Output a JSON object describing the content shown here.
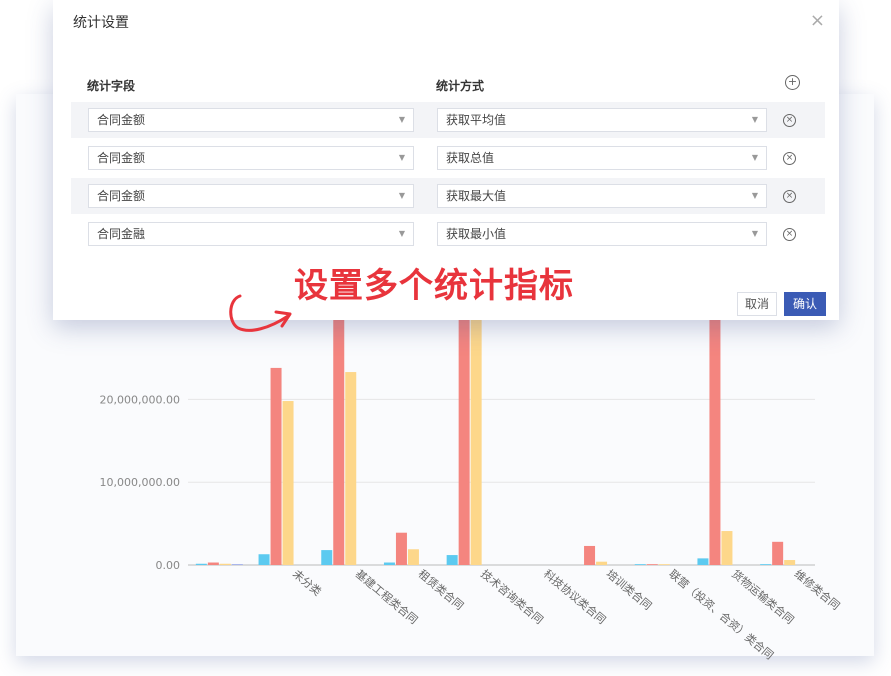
{
  "dialog": {
    "title": "统计设置",
    "close_glyph": "×",
    "field_header": "统计字段",
    "method_header": "统计方式",
    "rows": [
      {
        "field": "合同金额",
        "method": "获取平均值"
      },
      {
        "field": "合同金额",
        "method": "获取总值"
      },
      {
        "field": "合同金额",
        "method": "获取最大值"
      },
      {
        "field": "合同金融",
        "method": "获取最小值"
      }
    ],
    "cancel_label": "取消",
    "ok_label": "确认"
  },
  "annotation": {
    "text": "设置多个统计指标",
    "color": "#e8343c"
  },
  "chart_data": {
    "type": "bar",
    "categories": [
      "",
      "未分类",
      "基建工程类合同",
      "租赁类合同",
      "技术咨询类合同",
      "科技协议类合同",
      "培训类合同",
      "联营（投资、合资）类合同",
      "货物运输类合同",
      "维修类合同"
    ],
    "series": [
      {
        "values": [
          150000,
          1300000,
          1800000,
          300000,
          1200000,
          0,
          0,
          100000,
          800000,
          100000
        ]
      },
      {
        "values": [
          300000,
          23800000,
          32000000,
          3900000,
          32000000,
          0,
          2300000,
          100000,
          32000000,
          2800000
        ]
      },
      {
        "values": [
          150000,
          19800000,
          23300000,
          1900000,
          32000000,
          0,
          400000,
          100000,
          4100000,
          600000
        ]
      },
      {
        "values": [
          100000,
          0,
          0,
          0,
          0,
          0,
          0,
          0,
          0,
          0
        ]
      }
    ],
    "colors": [
      "#5ccaf0",
      "#f4857f",
      "#fdd78a",
      "#9aa7e8"
    ],
    "yticks": [
      "0.00",
      "10,000,000.00",
      "20,000,000.00"
    ],
    "ylim": [
      0,
      32000000
    ]
  }
}
